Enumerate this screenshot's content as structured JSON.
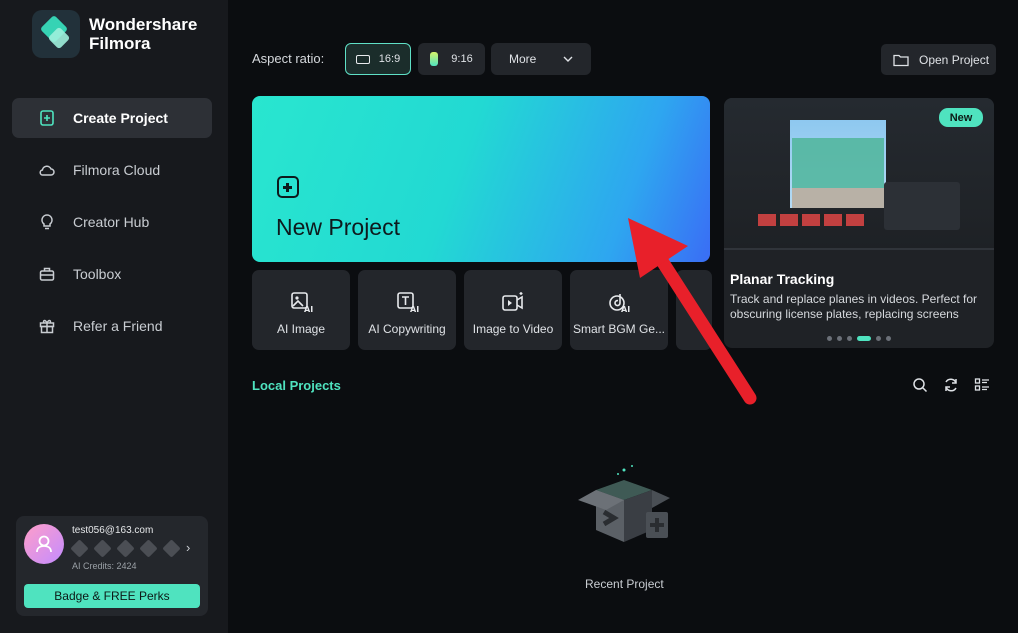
{
  "app": {
    "name_line1": "Wondershare",
    "name_line2": "Filmora"
  },
  "sidebar": {
    "items": [
      {
        "label": "Create Project",
        "icon": "create-project-icon",
        "active": true
      },
      {
        "label": "Filmora Cloud",
        "icon": "cloud-icon",
        "active": false
      },
      {
        "label": "Creator Hub",
        "icon": "lightbulb-icon",
        "active": false
      },
      {
        "label": "Toolbox",
        "icon": "toolbox-icon",
        "active": false
      },
      {
        "label": "Refer a Friend",
        "icon": "gift-icon",
        "active": false
      }
    ],
    "account": {
      "email": "test056@163.com",
      "credits": "AI Credits: 2424",
      "perks_button": "Badge & FREE Perks"
    }
  },
  "toolbar": {
    "aspect_label": "Aspect ratio:",
    "ratio_169": "16:9",
    "ratio_916": "9:16",
    "more_label": "More",
    "open_project": "Open Project"
  },
  "new_project": {
    "label": "New Project"
  },
  "tools": [
    {
      "label": "AI Image",
      "icon": "ai-image-icon"
    },
    {
      "label": "AI Copywriting",
      "icon": "ai-copywriting-icon"
    },
    {
      "label": "Image to Video",
      "icon": "image-to-video-icon"
    },
    {
      "label": "Smart BGM Ge...",
      "icon": "smart-bgm-icon"
    }
  ],
  "promo": {
    "badge": "New",
    "title": "Planar Tracking",
    "description": "Track and replace planes in videos. Perfect for obscuring license plates, replacing screens an...",
    "slide_count": 6,
    "active_slide": 4
  },
  "local_projects": {
    "title": "Local Projects",
    "empty_label": "Recent Project"
  },
  "colors": {
    "accent": "#4fe3bf",
    "annotation_arrow": "#e8202a"
  }
}
